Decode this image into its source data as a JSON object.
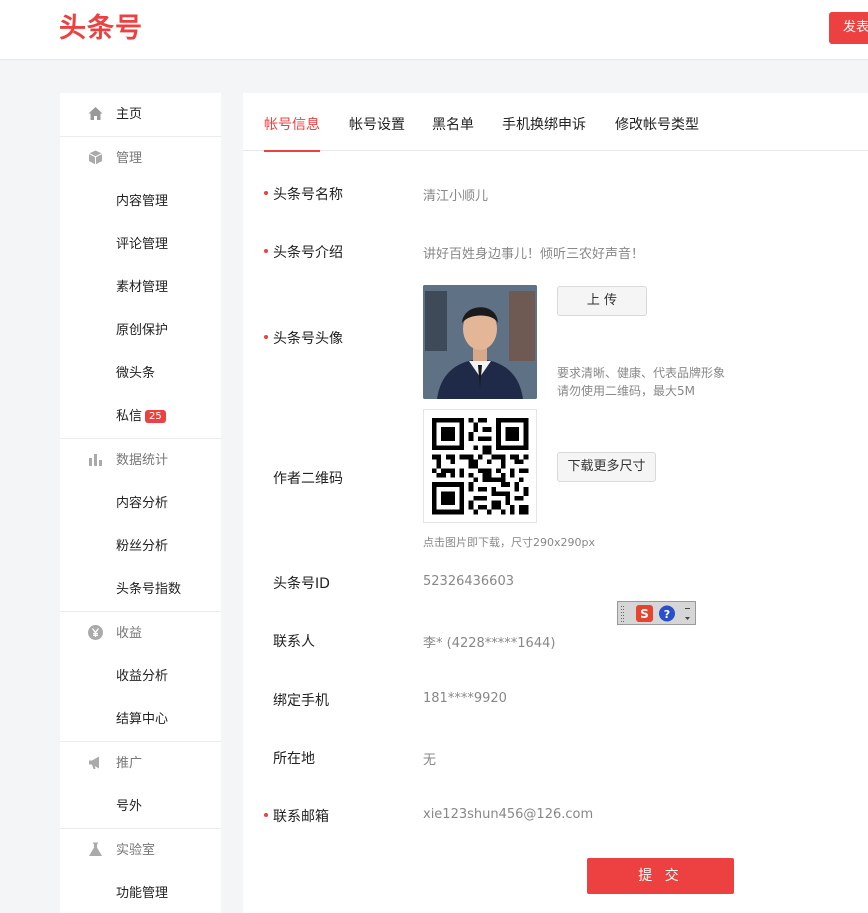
{
  "header": {
    "logo": "头条号",
    "publish_label": "发表"
  },
  "sidebar": {
    "home": "主页",
    "manage": "管理",
    "content_manage": "内容管理",
    "comment_manage": "评论管理",
    "material_manage": "素材管理",
    "original_protect": "原创保护",
    "weitoutiao": "微头条",
    "private_msg": "私信",
    "private_msg_count": "25",
    "stats": "数据统计",
    "content_analysis": "内容分析",
    "fans_analysis": "粉丝分析",
    "index": "头条号指数",
    "income": "收益",
    "income_analysis": "收益分析",
    "settlement": "结算中心",
    "promote": "推广",
    "haowai": "号外",
    "lab": "实验室",
    "feature_manage": "功能管理"
  },
  "tabs": [
    "帐号信息",
    "帐号设置",
    "黑名单",
    "手机换绑申诉",
    "修改帐号类型"
  ],
  "form": {
    "name_label": "头条号名称",
    "name_value": "清江小顺儿",
    "intro_label": "头条号介绍",
    "intro_value": "讲好百姓身边事儿！倾听三农好声音！",
    "avatar_label": "头条号头像",
    "upload_label": "上 传",
    "avatar_hint_1": "要求清晰、健康、代表品牌形象",
    "avatar_hint_2": "请勿使用二维码，最大5M",
    "qr_label": "作者二维码",
    "download_label": "下载更多尺寸",
    "qr_hint": "点击图片即下载，尺寸290x290px",
    "id_label": "头条号ID",
    "id_value": "52326436603",
    "contact_label": "联系人",
    "contact_value": "李* (4228*****1644)",
    "phone_label": "绑定手机",
    "phone_value": "181****9920",
    "location_label": "所在地",
    "location_value": "无",
    "email_label": "联系邮箱",
    "email_value": "xie123shun456@126.com",
    "submit_label": "提 交"
  },
  "colors": {
    "accent": "#ed4040"
  }
}
